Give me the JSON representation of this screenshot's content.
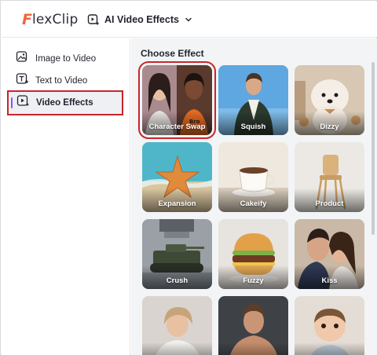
{
  "header": {
    "logo_initial": "F",
    "logo_rest": "lexClip",
    "product_label": "AI Video Effects"
  },
  "sidebar": {
    "items": [
      {
        "label": "Image to Video",
        "icon": "image-video-icon",
        "active": false
      },
      {
        "label": "Text to Video",
        "icon": "text-video-icon",
        "active": false
      },
      {
        "label": "Video Effects",
        "icon": "video-effects-icon",
        "active": true
      }
    ]
  },
  "main": {
    "section_title": "Choose Effect",
    "effects": [
      {
        "label": "Character Swap",
        "selected": true
      },
      {
        "label": "Squish",
        "selected": false
      },
      {
        "label": "Dizzy",
        "selected": false
      },
      {
        "label": "Expansion",
        "selected": false
      },
      {
        "label": "Cakeify",
        "selected": false
      },
      {
        "label": "Product",
        "selected": false
      },
      {
        "label": "Crush",
        "selected": false
      },
      {
        "label": "Fuzzy",
        "selected": false
      },
      {
        "label": "Kiss",
        "selected": false
      },
      {
        "label": "",
        "selected": false
      },
      {
        "label": "",
        "selected": false
      },
      {
        "label": "",
        "selected": false
      }
    ]
  },
  "colors": {
    "brand_orange": "#f0673a",
    "selection_red": "#c7262b",
    "active_accent": "#7b5cff"
  }
}
